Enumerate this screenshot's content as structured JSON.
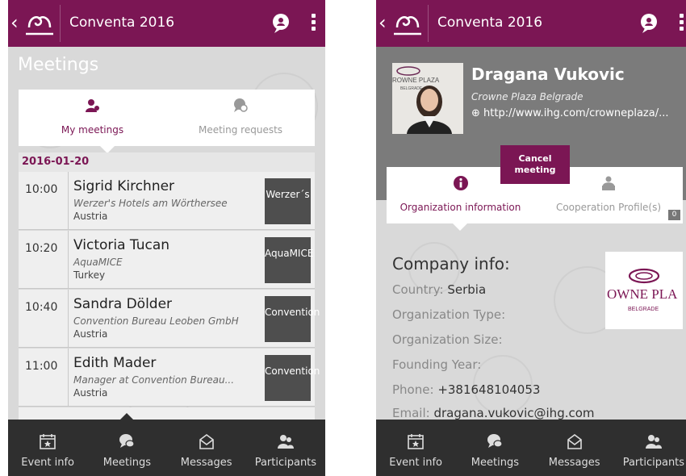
{
  "app": {
    "title": "Conventa 2016",
    "brand_color": "#7b1654"
  },
  "meetings_screen": {
    "page_title": "Meetings",
    "tabs": [
      {
        "label": "My meetings",
        "icon": "person-pin-icon",
        "active": true
      },
      {
        "label": "Meeting requests",
        "icon": "chat-search-icon",
        "active": false
      }
    ],
    "date": "2016-01-20",
    "meetings": [
      {
        "time": "10:00",
        "name": "Sigrid Kirchner",
        "org": "Werzer's Hotels am Wörthersee",
        "country": "Austria",
        "badge": "Werzer´s"
      },
      {
        "time": "10:20",
        "name": "Victoria Tucan",
        "org": "AquaMICE",
        "country": "Turkey",
        "badge": "AquaMICE"
      },
      {
        "time": "10:40",
        "name": "Sandra Dölder",
        "org": "Convention Bureau Leoben GmbH",
        "country": "Austria",
        "badge": "Convention"
      },
      {
        "time": "11:00",
        "name": "Edith Mader",
        "org": "Manager at Convention Bureau...",
        "country": "Austria",
        "badge": "Convention"
      }
    ]
  },
  "profile_screen": {
    "name": "Dragana Vukovic",
    "company": "Crowne Plaza Belgrade",
    "url": "http://www.ihg.com/crowneplaza/...",
    "cancel_button": "Cancel meeting",
    "tabs": [
      {
        "label": "Organization information",
        "icon": "info-icon",
        "active": true
      },
      {
        "label": "Cooperation Profile(s)",
        "icon": "handshake-icon",
        "active": false,
        "count": "0"
      }
    ],
    "company_info_title": "Company info:",
    "fields": {
      "country_label": "Country:",
      "country_value": "Serbia",
      "org_type_label": "Organization Type:",
      "org_size_label": "Organization Size:",
      "founding_label": "Founding Year:",
      "phone_label": "Phone:",
      "phone_value": "+381648104053",
      "email_label": "Email:",
      "email_value": "dragana.vukovic@ihg.com"
    },
    "logo_text": "OWNE PLA",
    "logo_subtext": "BELGRADE",
    "photo_sign_text": "ROWNE PLAZA",
    "photo_sign_sub": "BELGRADE"
  },
  "bottom_nav": [
    {
      "label": "Event info",
      "icon": "calendar-star-icon"
    },
    {
      "label": "Meetings",
      "icon": "chat-bubbles-icon"
    },
    {
      "label": "Messages",
      "icon": "envelope-icon"
    },
    {
      "label": "Participants",
      "icon": "people-icon"
    }
  ]
}
